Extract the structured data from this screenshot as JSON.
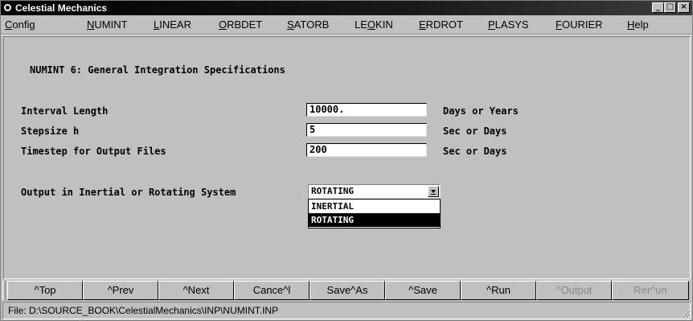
{
  "window": {
    "title": "Celestial Mechanics",
    "controls": {
      "minimize": "_",
      "maximize": "□",
      "close": "×"
    }
  },
  "menu": [
    {
      "label": "Config",
      "underline_index": 0
    },
    {
      "label": "NUMINT",
      "underline_index": 0
    },
    {
      "label": "LINEAR",
      "underline_index": 0
    },
    {
      "label": "ORBDET",
      "underline_index": 0
    },
    {
      "label": "SATORB",
      "underline_index": 0
    },
    {
      "label": "LEOKIN",
      "underline_index": 2
    },
    {
      "label": "ERDROT",
      "underline_index": 0
    },
    {
      "label": "PLASYS",
      "underline_index": 0
    },
    {
      "label": "FOURIER",
      "underline_index": 0
    },
    {
      "label": "Help",
      "underline_index": 0
    }
  ],
  "form": {
    "heading": "NUMINT 6: General Integration Specifications",
    "fields": [
      {
        "label": "Interval Length",
        "value": "10000.",
        "unit": "Days or Years"
      },
      {
        "label": "Stepsize h",
        "value": "5",
        "unit": "Sec or Days"
      },
      {
        "label": "Timestep for Output Files",
        "value": "200",
        "unit": "Sec or Days"
      }
    ],
    "system": {
      "label": "Output in Inertial or Rotating System",
      "selected": "ROTATING",
      "options": [
        "INERTIAL",
        "ROTATING"
      ],
      "highlighted_option": "ROTATING"
    }
  },
  "buttons": [
    {
      "label": "^Top",
      "enabled": true
    },
    {
      "label": "^Prev",
      "enabled": true
    },
    {
      "label": "^Next",
      "enabled": true
    },
    {
      "label": "Cance^l",
      "enabled": true
    },
    {
      "label": "Save^As",
      "enabled": true
    },
    {
      "label": "^Save",
      "enabled": true
    },
    {
      "label": "^Run",
      "enabled": true
    },
    {
      "label": "^Output",
      "enabled": false
    },
    {
      "label": "Rer^un",
      "enabled": false
    }
  ],
  "status": {
    "text": "File: D:\\SOURCE_BOOK\\CelestialMechanics\\INP\\NUMINT.INP"
  }
}
